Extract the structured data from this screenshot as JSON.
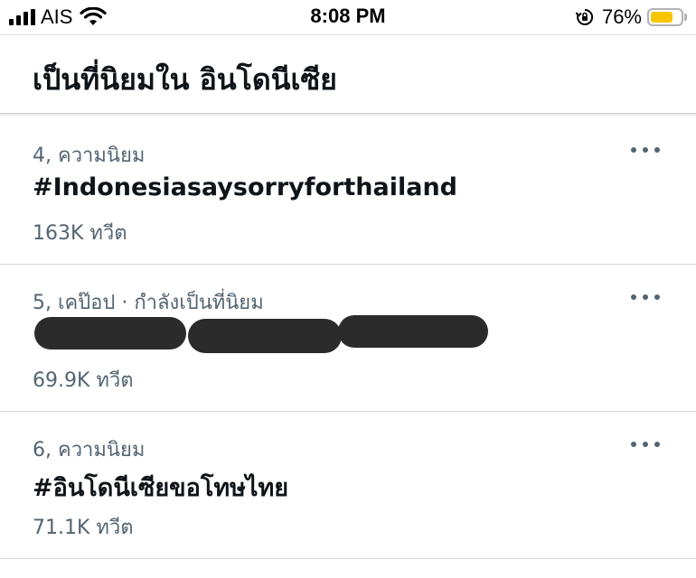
{
  "status_bar": {
    "carrier": "AIS",
    "time": "8:08 PM",
    "battery_percent": "76%",
    "battery_level": 0.76,
    "battery_color": "#f7c600"
  },
  "header": {
    "title": "เป็นที่นิยมใน อินโดนีเซีย"
  },
  "trends": [
    {
      "meta": "4, ความนิยม",
      "name": "#Indonesiasaysorryforthailand",
      "count": "163K ทวีต"
    },
    {
      "meta": "5, เคป๊อป · กำลังเป็นที่นิยม",
      "name": "",
      "count": "69.9K ทวีต"
    },
    {
      "meta": "6, ความนิยม",
      "name": "#อินโดนีเซียขอโทษไทย",
      "count": "71.1K ทวีต"
    }
  ],
  "icons": {
    "signal": "signal-bars-icon",
    "wifi": "wifi-icon",
    "rotation_lock": "rotation-lock-icon",
    "battery": "battery-icon",
    "more": "more-horizontal-icon"
  }
}
